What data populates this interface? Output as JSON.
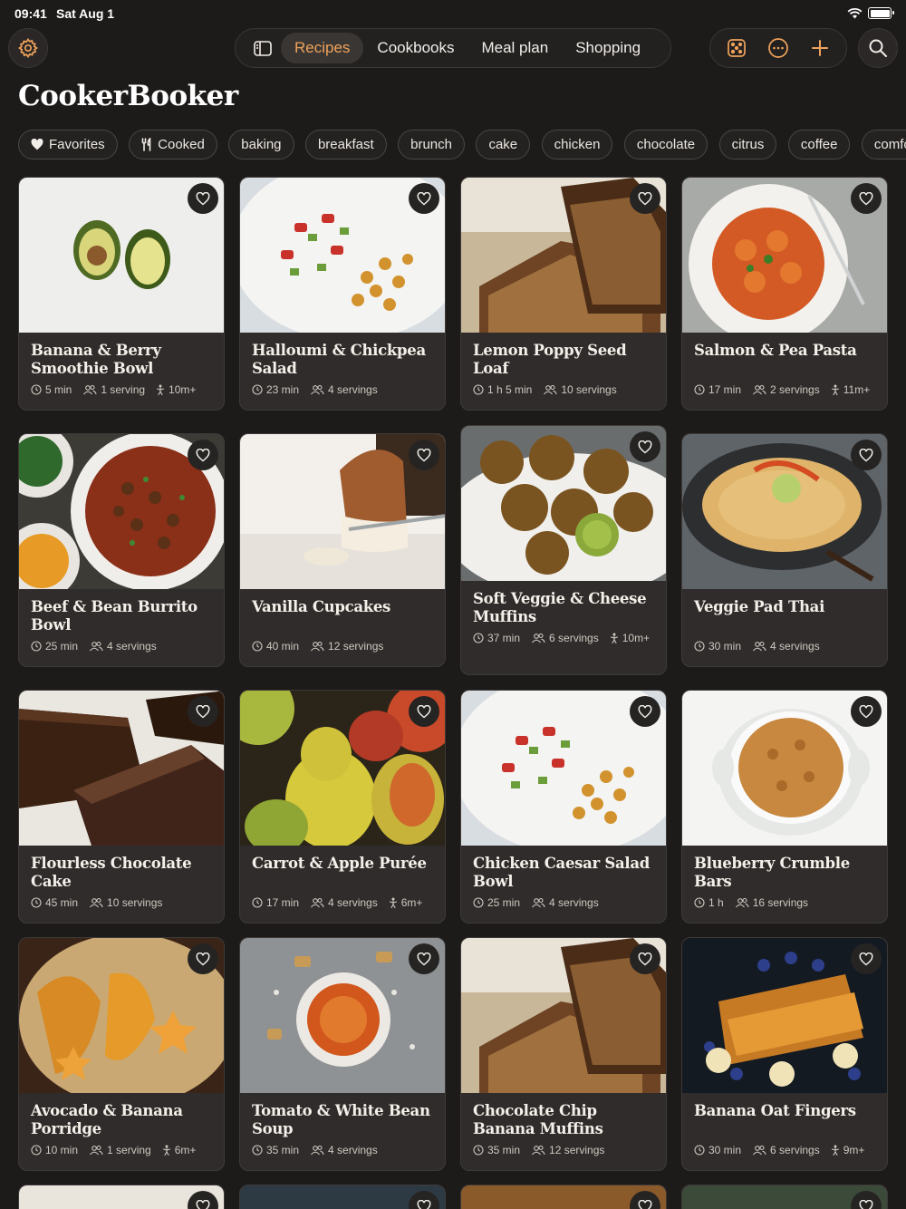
{
  "status": {
    "time": "09:41",
    "date": "Sat Aug 1"
  },
  "nav": {
    "tabs": [
      "Recipes",
      "Cookbooks",
      "Meal plan",
      "Shopping"
    ],
    "active": "Recipes"
  },
  "app_title": "CookerBooker",
  "chips": [
    "Favorites",
    "Cooked",
    "baking",
    "breakfast",
    "brunch",
    "cake",
    "chicken",
    "chocolate",
    "citrus",
    "coffee",
    "comfort"
  ],
  "recipes": [
    {
      "title": "Banana & Berry Smoothie Bowl",
      "time": "5 min",
      "servings": "1 serving",
      "age": "10m+",
      "image": "avocado-halves"
    },
    {
      "title": "Halloumi & Chickpea Salad",
      "time": "23 min",
      "servings": "4 servings",
      "age": "",
      "image": "chickpea-salad"
    },
    {
      "title": "Lemon Poppy Seed Loaf",
      "time": "1 h 5 min",
      "servings": "10 servings",
      "age": "",
      "image": "banana-bread"
    },
    {
      "title": "Salmon & Pea Pasta",
      "time": "17 min",
      "servings": "2 servings",
      "age": "11m+",
      "image": "pasta-plate"
    },
    {
      "title": "Beef & Bean Burrito Bowl",
      "time": "25 min",
      "servings": "4 servings",
      "age": "",
      "image": "chili-bowl"
    },
    {
      "title": "Vanilla Cupcakes",
      "time": "40 min",
      "servings": "12 servings",
      "age": "",
      "image": "carrot-cake"
    },
    {
      "title": "Soft Veggie & Cheese Muffins",
      "time": "37 min",
      "servings": "6 servings",
      "age": "10m+",
      "image": "falafel"
    },
    {
      "title": "Veggie Pad Thai",
      "time": "30 min",
      "servings": "4 servings",
      "age": "",
      "image": "soup-bowl"
    },
    {
      "title": "Flourless Chocolate Cake",
      "time": "45 min",
      "servings": "10 servings",
      "age": "",
      "image": "brownies"
    },
    {
      "title": "Carrot & Apple Purée",
      "time": "17 min",
      "servings": "4 servings",
      "age": "6m+",
      "image": "pears"
    },
    {
      "title": "Chicken Caesar Salad Bowl",
      "time": "25 min",
      "servings": "4 servings",
      "age": "",
      "image": "chickpea-salad"
    },
    {
      "title": "Blueberry Crumble Bars",
      "time": "1 h",
      "servings": "16 servings",
      "age": "",
      "image": "crumble-pot"
    },
    {
      "title": "Avocado & Banana Porridge",
      "time": "10 min",
      "servings": "1 serving",
      "age": "6m+",
      "image": "porridge"
    },
    {
      "title": "Tomato & White Bean Soup",
      "time": "35 min",
      "servings": "4 servings",
      "age": "",
      "image": "tomato-soup"
    },
    {
      "title": "Chocolate Chip Banana Muffins",
      "time": "35 min",
      "servings": "12 servings",
      "age": "",
      "image": "banana-bread"
    },
    {
      "title": "Banana Oat Fingers",
      "time": "30 min",
      "servings": "6 servings",
      "age": "9m+",
      "image": "french-toast"
    }
  ]
}
